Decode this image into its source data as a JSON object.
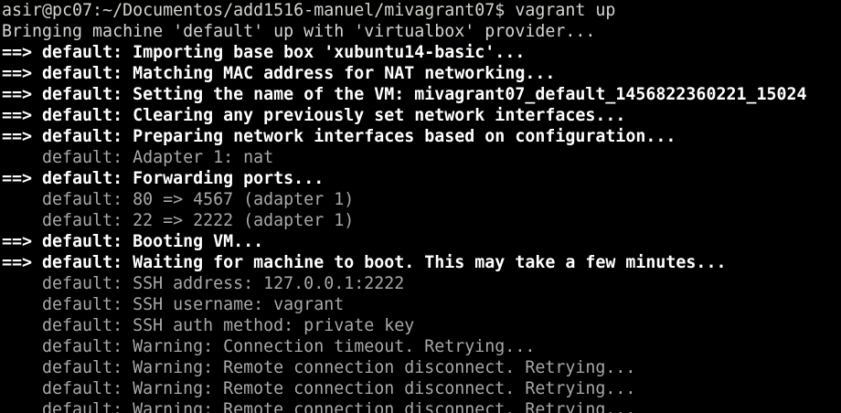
{
  "terminal": {
    "prompt": "asir@pc07:~/Documentos/add1516-manuel/mivagrant07$ ",
    "command": "vagrant up",
    "lines": [
      {
        "kind": "plain",
        "text": "Bringing machine 'default' up with 'virtualbox' provider..."
      },
      {
        "kind": "bold",
        "arrow": "==> ",
        "text": "default: Importing base box 'xubuntu14-basic'..."
      },
      {
        "kind": "bold",
        "arrow": "==> ",
        "text": "default: Matching MAC address for NAT networking..."
      },
      {
        "kind": "bold",
        "arrow": "==> ",
        "text": "default: Setting the name of the VM: mivagrant07_default_1456822360221_15024"
      },
      {
        "kind": "bold",
        "arrow": "==> ",
        "text": "default: Clearing any previously set network interfaces..."
      },
      {
        "kind": "bold",
        "arrow": "==> ",
        "text": "default: Preparing network interfaces based on configuration..."
      },
      {
        "kind": "gray",
        "text": "    default: Adapter 1: nat"
      },
      {
        "kind": "bold",
        "arrow": "==> ",
        "text": "default: Forwarding ports..."
      },
      {
        "kind": "gray",
        "text": "    default: 80 => 4567 (adapter 1)"
      },
      {
        "kind": "gray",
        "text": "    default: 22 => 2222 (adapter 1)"
      },
      {
        "kind": "bold",
        "arrow": "==> ",
        "text": "default: Booting VM..."
      },
      {
        "kind": "bold",
        "arrow": "==> ",
        "text": "default: Waiting for machine to boot. This may take a few minutes..."
      },
      {
        "kind": "gray",
        "text": "    default: SSH address: 127.0.0.1:2222"
      },
      {
        "kind": "gray",
        "text": "    default: SSH username: vagrant"
      },
      {
        "kind": "gray",
        "text": "    default: SSH auth method: private key"
      },
      {
        "kind": "gray",
        "text": "    default: Warning: Connection timeout. Retrying..."
      },
      {
        "kind": "gray",
        "text": "    default: Warning: Remote connection disconnect. Retrying..."
      },
      {
        "kind": "gray",
        "text": "    default: Warning: Remote connection disconnect. Retrying..."
      },
      {
        "kind": "gray",
        "text": "    default: Warning: Remote connection disconnect. Retrying..."
      }
    ]
  },
  "colors": {
    "background": "#000000",
    "plain": "#d3d7cf",
    "bold": "#ffffff",
    "gray": "#a8a8a8"
  }
}
